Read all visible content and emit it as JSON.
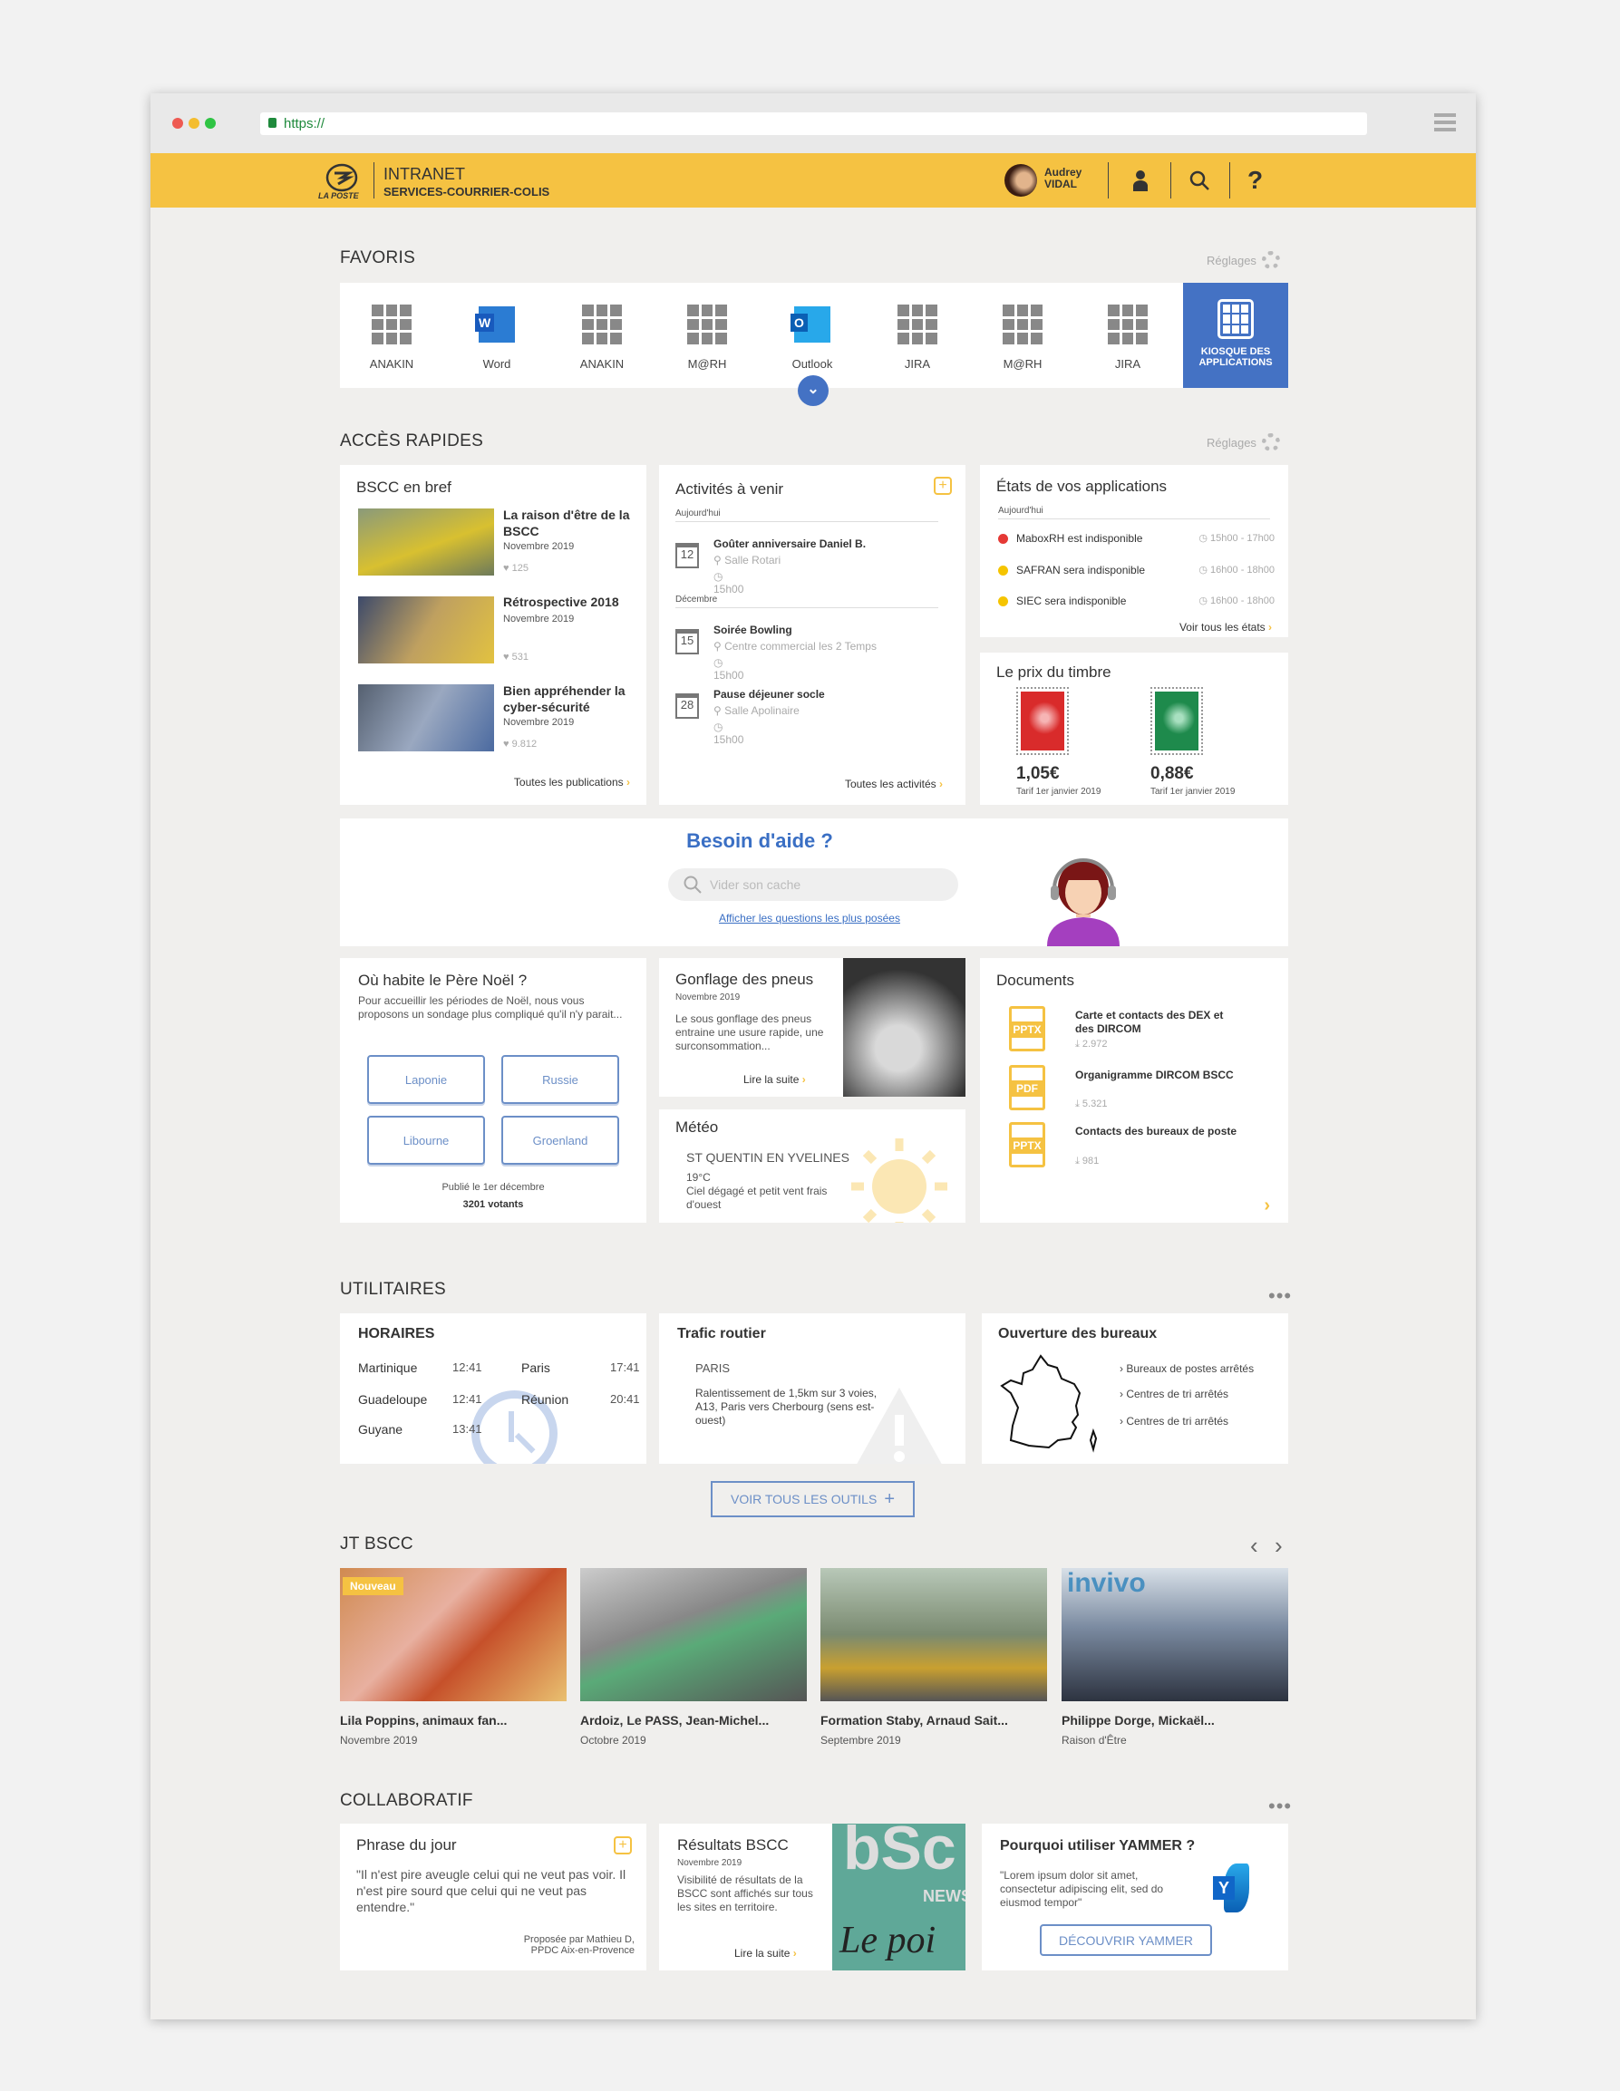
{
  "browser": {
    "url": "https://"
  },
  "header": {
    "logo_text": "LA POSTE",
    "title": "INTRANET",
    "subtitle": "SERVICES-COURRIER-COLIS",
    "user_first": "Audrey",
    "user_last": "VIDAL",
    "accent": "#F5C242"
  },
  "favoris": {
    "title": "FAVORIS",
    "settings": "Réglages",
    "items": [
      {
        "label": "ANAKIN",
        "icon": "grid-icon"
      },
      {
        "label": "Word",
        "icon": "word-icon"
      },
      {
        "label": "ANAKIN",
        "icon": "grid-icon"
      },
      {
        "label": "M@RH",
        "icon": "grid-icon"
      },
      {
        "label": "Outlook",
        "icon": "outlook-icon"
      },
      {
        "label": "JIRA",
        "icon": "grid-icon"
      },
      {
        "label": "M@RH",
        "icon": "grid-icon"
      },
      {
        "label": "JIRA",
        "icon": "grid-icon"
      }
    ],
    "kiosque": "KIOSQUE DES APPLICATIONS"
  },
  "acces": {
    "title": "ACCÈS RAPIDES",
    "settings": "Réglages",
    "bref": {
      "title": "BSCC en bref",
      "items": [
        {
          "title": "La raison d'être de la BSCC",
          "date": "Novembre 2019",
          "likes": "125"
        },
        {
          "title": "Rétrospective 2018",
          "date": "Novembre 2019",
          "likes": "531"
        },
        {
          "title": "Bien appréhender la cyber-sécurité",
          "date": "Novembre 2019",
          "likes": "9.812"
        }
      ],
      "link": "Toutes les publications"
    },
    "activites": {
      "title": "Activités à venir",
      "groups": [
        {
          "label": "Aujourd'hui",
          "events": [
            {
              "day": "12",
              "title": "Goûter anniversaire Daniel B.",
              "place": "Salle Rotari",
              "time": "15h00"
            }
          ]
        },
        {
          "label": "Décembre",
          "events": [
            {
              "day": "15",
              "title": "Soirée Bowling",
              "place": "Centre commercial les 2 Temps",
              "time": "15h00"
            },
            {
              "day": "28",
              "title": "Pause déjeuner socle",
              "place": "Salle Apolinaire",
              "time": "15h00"
            }
          ]
        }
      ],
      "link": "Toutes les activités"
    },
    "etats": {
      "title": "États de vos applications",
      "subtitle": "Aujourd'hui",
      "items": [
        {
          "label": "MaboxRH est indisponible",
          "time": "15h00 - 17h00",
          "color": "#E53935"
        },
        {
          "label": "SAFRAN sera indisponible",
          "time": "16h00 - 18h00",
          "color": "#F5C400"
        },
        {
          "label": "SIEC sera indisponible",
          "time": "16h00 - 18h00",
          "color": "#F5C400"
        }
      ],
      "link": "Voir tous les états"
    },
    "timbre": {
      "title": "Le prix du timbre",
      "items": [
        {
          "price": "1,05€",
          "note": "Tarif 1er janvier 2019",
          "color": "#D92B2B"
        },
        {
          "price": "0,88€",
          "note": "Tarif 1er janvier 2019",
          "color": "#1E8A4C"
        }
      ]
    },
    "aide": {
      "title": "Besoin d'aide ?",
      "placeholder": "Vider son cache",
      "link": "Afficher les questions les plus posées"
    },
    "sondage": {
      "title": "Où habite le Père Noël ?",
      "text": "Pour accueillir les périodes de Noël, nous vous proposons un sondage plus compliqué qu'il n'y parait...",
      "options": [
        "Laponie",
        "Russie",
        "Libourne",
        "Groenland"
      ],
      "published": "Publié le 1er décembre",
      "votes": "3201 votants"
    },
    "article": {
      "title": "Gonflage des pneus",
      "date": "Novembre 2019",
      "text": "Le sous gonflage des pneus entraine une usure rapide, une surconsommation...",
      "link": "Lire la suite"
    },
    "meteo": {
      "title": "Météo",
      "city": "ST QUENTIN EN YVELINES",
      "temp": "19°C",
      "desc": "Ciel dégagé et petit vent frais d'ouest"
    },
    "documents": {
      "title": "Documents",
      "items": [
        {
          "type": "PPTX",
          "title": "Carte et contacts des DEX et des DIRCOM",
          "downloads": "2.972"
        },
        {
          "type": "PDF",
          "title": "Organigramme DIRCOM BSCC",
          "downloads": "5.321"
        },
        {
          "type": "PPTX",
          "title": "Contacts des bureaux de poste",
          "downloads": "981"
        }
      ]
    }
  },
  "utilitaires": {
    "title": "UTILITAIRES",
    "horaires": {
      "title": "HORAIRES",
      "rows": [
        {
          "city": "Martinique",
          "time": "12:41"
        },
        {
          "city": "Paris",
          "time": "17:41"
        },
        {
          "city": "Guadeloupe",
          "time": "12:41"
        },
        {
          "city": "Réunion",
          "time": "20:41"
        },
        {
          "city": "Guyane",
          "time": "13:41"
        }
      ]
    },
    "trafic": {
      "title": "Trafic routier",
      "city": "PARIS",
      "text": "Ralentissement de 1,5km sur 3 voies, A13, Paris vers Cherbourg (sens est-ouest)"
    },
    "bureaux": {
      "title": "Ouverture des bureaux",
      "links": [
        "Bureaux de postes arrêtés",
        "Centres de tri arrêtés",
        "Centres de tri arrêtés"
      ]
    },
    "button": "VOIR TOUS LES OUTILS"
  },
  "jt": {
    "title": "JT BSCC",
    "badge": "Nouveau",
    "items": [
      {
        "title": "Lila Poppins, animaux fan...",
        "date": "Novembre 2019"
      },
      {
        "title": "Ardoiz, Le PASS, Jean-Michel...",
        "date": "Octobre 2019"
      },
      {
        "title": "Formation Staby, Arnaud Sait...",
        "date": "Septembre 2019"
      },
      {
        "title": "Philippe Dorge, Mickaël...",
        "date": "Raison d'Être"
      }
    ]
  },
  "collab": {
    "title": "COLLABORATIF",
    "phrase": {
      "title": "Phrase du jour",
      "quote": "\"Il n'est pire aveugle celui qui ne veut pas voir. Il n'est pire sourd que celui qui ne veut pas entendre.\"",
      "author1": "Proposée par Mathieu D,",
      "author2": "PPDC Aix-en-Provence"
    },
    "resultats": {
      "title": "Résultats BSCC",
      "date": "Novembre 2019",
      "text": "Visibilité de résultats de la BSCC sont affichés sur tous les sites en territoire.",
      "link": "Lire la suite",
      "image_text1": "bSc",
      "image_text2": "NEWS",
      "image_text3": "Le poi"
    },
    "yammer": {
      "title": "Pourquoi utiliser YAMMER ?",
      "text": "\"Lorem ipsum dolor sit amet, consectetur adipiscing elit, sed do eiusmod tempor\"",
      "button": "DÉCOUVRIR YAMMER"
    }
  }
}
